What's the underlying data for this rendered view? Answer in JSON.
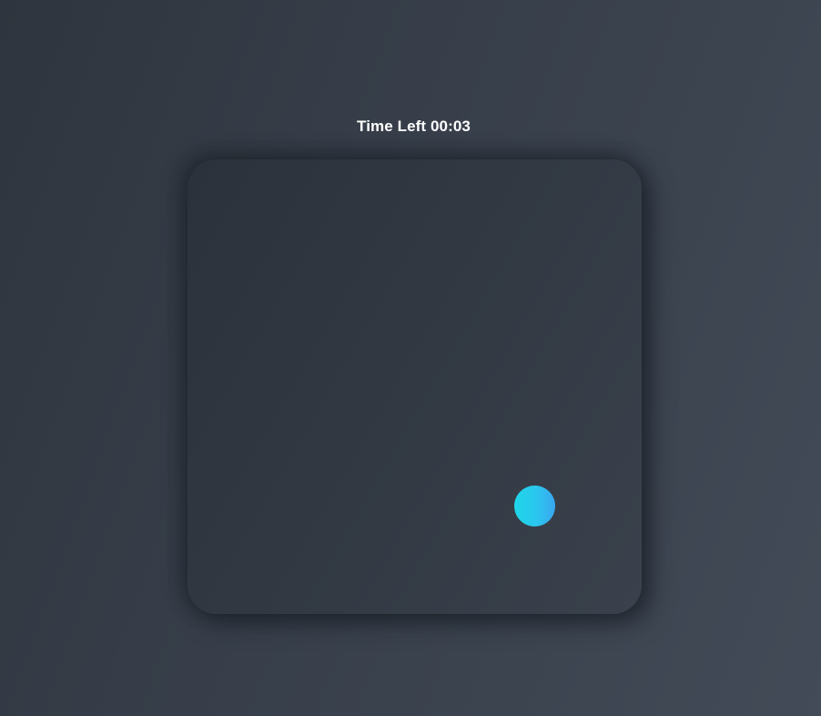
{
  "game": {
    "timer_text": "Time Left 00:03",
    "target": {
      "icon": "circle-target",
      "gradient_start": "#1fd6e8",
      "gradient_end": "#3aa7f0"
    }
  },
  "colors": {
    "background": "#3a414c",
    "board": "#323943",
    "text": "#ffffff"
  }
}
